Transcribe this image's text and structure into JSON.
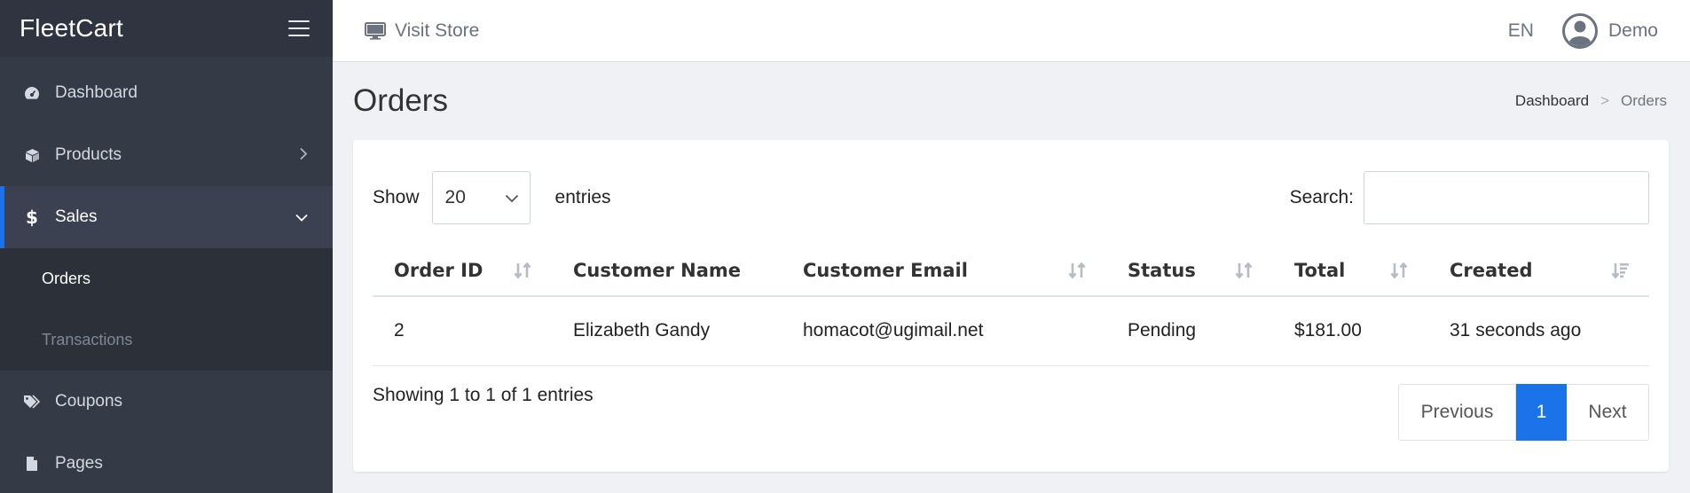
{
  "app": {
    "brand": "FleetCart"
  },
  "sidebar": {
    "items": [
      {
        "label": "Dashboard",
        "icon": "dashboard-icon"
      },
      {
        "label": "Products",
        "icon": "box-icon",
        "has_children": true
      },
      {
        "label": "Sales",
        "icon": "dollar-icon",
        "has_children": true,
        "expanded": true,
        "active": true,
        "children": [
          {
            "label": "Orders",
            "current": true
          },
          {
            "label": "Transactions"
          }
        ]
      },
      {
        "label": "Coupons",
        "icon": "tags-icon"
      },
      {
        "label": "Pages",
        "icon": "file-icon"
      }
    ]
  },
  "topbar": {
    "visit_store": "Visit Store",
    "language": "EN",
    "user_name": "Demo"
  },
  "page": {
    "title": "Orders",
    "breadcrumb": [
      "Dashboard",
      "Orders"
    ],
    "breadcrumb_separator": ">"
  },
  "table_controls": {
    "show_label": "Show",
    "page_size": "20",
    "entries_label": "entries",
    "search_label": "Search:",
    "search_value": ""
  },
  "table": {
    "columns": [
      "Order ID",
      "Customer Name",
      "Customer Email",
      "Status",
      "Total",
      "Created"
    ],
    "rows": [
      [
        "2",
        "Elizabeth Gandy",
        "homacot@ugimail.net",
        "Pending",
        "$181.00",
        "31 seconds ago"
      ]
    ]
  },
  "footer": {
    "info": "Showing 1 to 1 of 1 entries",
    "previous": "Previous",
    "current_page": "1",
    "next": "Next"
  },
  "colors": {
    "accent": "#1a73e8",
    "sidebar_bg": "#343a46",
    "content_bg": "#eff1f5"
  }
}
